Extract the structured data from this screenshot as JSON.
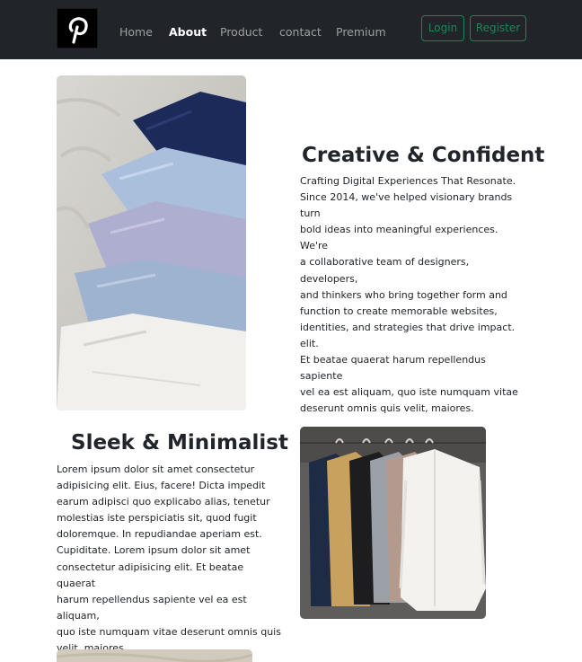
{
  "navbar": {
    "brand_icon": "pinterest-logo-icon",
    "links": [
      {
        "label": "Home",
        "active": false
      },
      {
        "label": "About",
        "active": true
      },
      {
        "label": "Product",
        "active": false
      },
      {
        "label": "contact",
        "active": false
      },
      {
        "label": "Premium",
        "active": false
      }
    ],
    "login_label": "Login",
    "register_label": "Register",
    "accent_color": "#198754",
    "background_color": "#212529"
  },
  "sections": [
    {
      "heading": "Creative & Confident",
      "lines": [
        "Crafting Digital Experiences That Resonate.",
        "Since 2014, we've helped visionary brands turn",
        "bold ideas into meaningful experiences. We're",
        "a collaborative team of designers, developers,",
        "and thinkers who bring together form and",
        "function to create memorable websites,",
        "identities, and strategies that drive impact. elit.",
        "Et beatae quaerat harum repellendus sapiente",
        "vel ea est aliquam, quo iste numquam vitae",
        "deserunt omnis quis velit, maiores."
      ]
    },
    {
      "heading": "Sleek & Minimalist",
      "lines": [
        "Lorem ipsum dolor sit amet consectetur",
        "adipisicing elit. Eius, facere! Dicta impedit",
        "earum adipisci quo explicabo alias, tenetur",
        "molestias iste perspiciatis sit, quod fugit",
        "doloremque. In repudiandae aperiam est.",
        "Cupiditate. Lorem ipsum dolor sit amet",
        "consectetur adipisicing elit. Et beatae quaerat",
        "harum repellendus sapiente vel ea est aliquam,",
        "quo iste numquam vitae deserunt omnis quis",
        "velit, maiores."
      ]
    }
  ]
}
